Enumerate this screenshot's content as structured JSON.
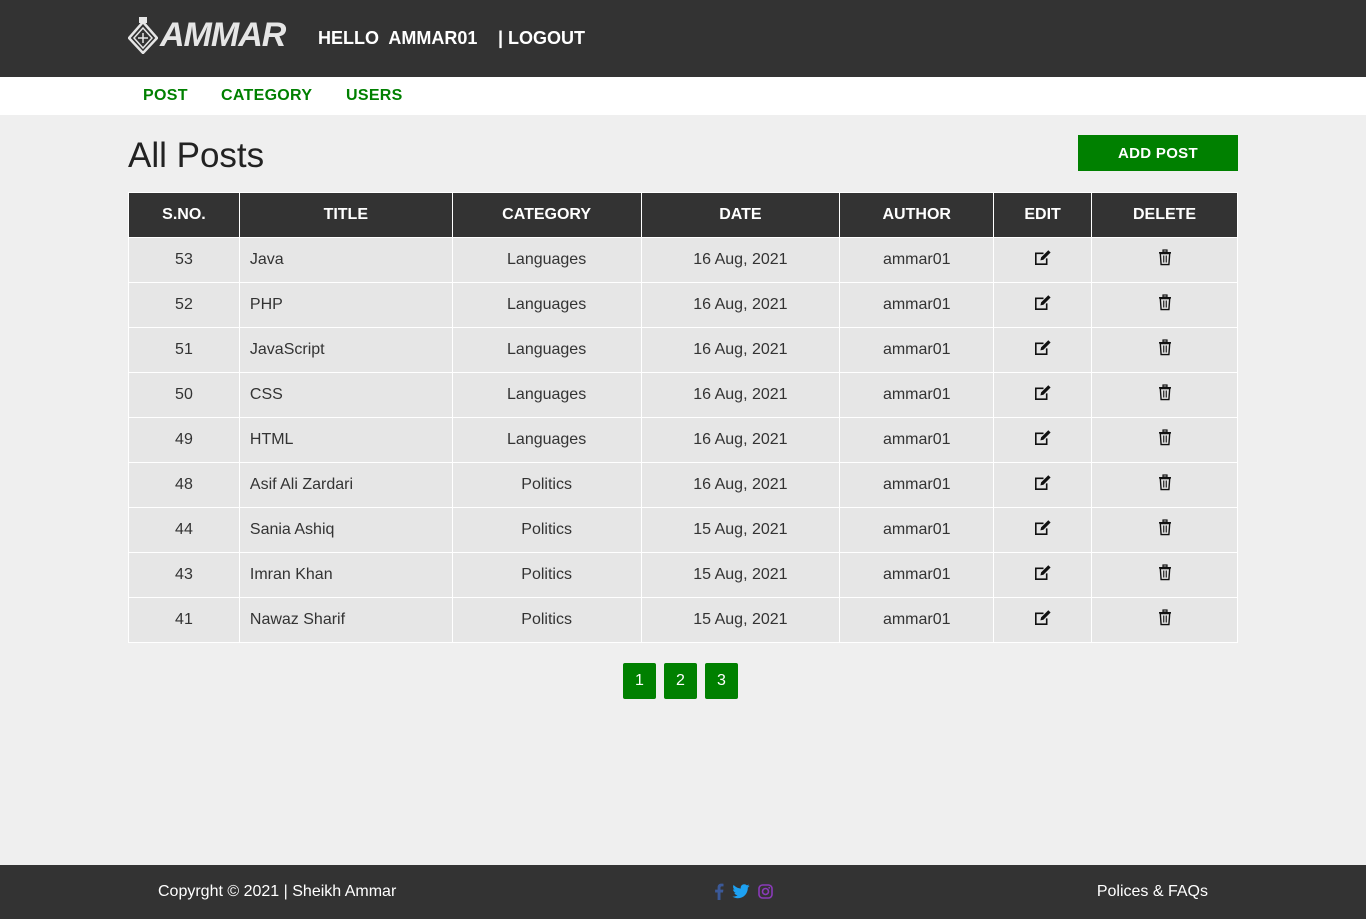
{
  "brand": {
    "logo_text": "AMMAR"
  },
  "header": {
    "greeting": "HELLO  AMMAR01",
    "logout_label": "| LOGOUT"
  },
  "nav": {
    "items": [
      {
        "label": "POST"
      },
      {
        "label": "CATEGORY"
      },
      {
        "label": "USERS"
      }
    ]
  },
  "main": {
    "title": "All Posts",
    "add_post_label": "ADD POST"
  },
  "table": {
    "headers": [
      "S.NO.",
      "TITLE",
      "CATEGORY",
      "DATE",
      "AUTHOR",
      "EDIT",
      "DELETE"
    ],
    "rows": [
      {
        "sno": "53",
        "title": "Java",
        "category": "Languages",
        "date": "16 Aug, 2021",
        "author": "ammar01"
      },
      {
        "sno": "52",
        "title": "PHP",
        "category": "Languages",
        "date": "16 Aug, 2021",
        "author": "ammar01"
      },
      {
        "sno": "51",
        "title": "JavaScript",
        "category": "Languages",
        "date": "16 Aug, 2021",
        "author": "ammar01"
      },
      {
        "sno": "50",
        "title": "CSS",
        "category": "Languages",
        "date": "16 Aug, 2021",
        "author": "ammar01"
      },
      {
        "sno": "49",
        "title": "HTML",
        "category": "Languages",
        "date": "16 Aug, 2021",
        "author": "ammar01"
      },
      {
        "sno": "48",
        "title": "Asif Ali Zardari",
        "category": "Politics",
        "date": "16 Aug, 2021",
        "author": "ammar01"
      },
      {
        "sno": "44",
        "title": "Sania Ashiq",
        "category": "Politics",
        "date": "15 Aug, 2021",
        "author": "ammar01"
      },
      {
        "sno": "43",
        "title": "Imran Khan",
        "category": "Politics",
        "date": "15 Aug, 2021",
        "author": "ammar01"
      },
      {
        "sno": "41",
        "title": "Nawaz Sharif",
        "category": "Politics",
        "date": "15 Aug, 2021",
        "author": "ammar01"
      }
    ],
    "edit_icon": "edit-icon",
    "delete_icon": "trash-icon"
  },
  "pagination": {
    "pages": [
      "1",
      "2",
      "3"
    ]
  },
  "footer": {
    "copyright": "Copyrght © 2021 | Sheikh Ammar",
    "social": [
      "facebook-icon",
      "twitter-icon",
      "instagram-icon"
    ],
    "policies_label": "Polices & FAQs"
  },
  "colors": {
    "header_bg": "#333333",
    "accent": "#008000",
    "page_bg": "#efefef",
    "row_bg": "#e6e6e6",
    "facebook": "#3b5998",
    "twitter": "#1da1f2",
    "instagram": "#8a3ab9"
  }
}
